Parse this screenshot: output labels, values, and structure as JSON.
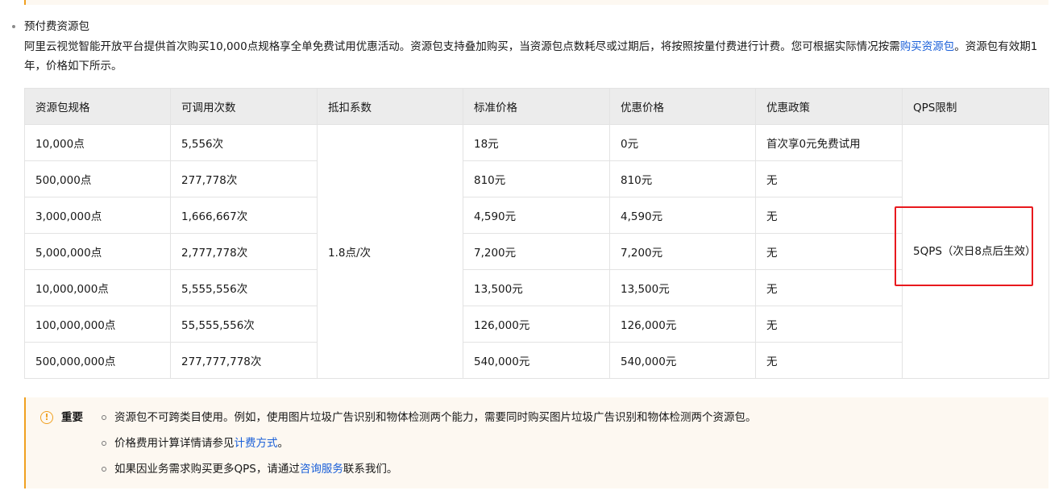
{
  "section": {
    "title": "预付费资源包",
    "intro_before_link": "阿里云视觉智能开放平台提供首次购买10,000点规格享全单免费试用优惠活动。资源包支持叠加购买，当资源包点数耗尽或过期后，将按照按量付费进行计费。您可根据实际情况按需",
    "intro_link": "购买资源包",
    "intro_after_link": "。资源包有效期1年，价格如下所示。"
  },
  "table": {
    "headers": [
      "资源包规格",
      "可调用次数",
      "抵扣系数",
      "标准价格",
      "优惠价格",
      "优惠政策",
      "QPS限制"
    ],
    "deduction": "1.8点/次",
    "qps_limit": "5QPS（次日8点后生效）",
    "rows": [
      {
        "spec": "10,000点",
        "calls": "5,556次",
        "standard": "18元",
        "discount": "0元",
        "policy": "首次享0元免费试用"
      },
      {
        "spec": "500,000点",
        "calls": "277,778次",
        "standard": "810元",
        "discount": "810元",
        "policy": "无"
      },
      {
        "spec": "3,000,000点",
        "calls": "1,666,667次",
        "standard": "4,590元",
        "discount": "4,590元",
        "policy": "无"
      },
      {
        "spec": "5,000,000点",
        "calls": "2,777,778次",
        "standard": "7,200元",
        "discount": "7,200元",
        "policy": "无"
      },
      {
        "spec": "10,000,000点",
        "calls": "5,555,556次",
        "standard": "13,500元",
        "discount": "13,500元",
        "policy": "无"
      },
      {
        "spec": "100,000,000点",
        "calls": "55,555,556次",
        "standard": "126,000元",
        "discount": "126,000元",
        "policy": "无"
      },
      {
        "spec": "500,000,000点",
        "calls": "277,777,778次",
        "standard": "540,000元",
        "discount": "540,000元",
        "policy": "无"
      }
    ]
  },
  "important": {
    "icon": "warning-circle-icon",
    "label": "重要",
    "items": [
      {
        "text": "资源包不可跨类目使用。例如，使用图片垃圾广告识别和物体检测两个能力，需要同时购买图片垃圾广告识别和物体检测两个资源包。"
      },
      {
        "text": "价格费用计算详情请参见",
        "link": "计费方式",
        "after": "。"
      },
      {
        "text": "如果因业务需求购买更多QPS，请通过",
        "link": "咨询服务",
        "after": "联系我们。"
      }
    ]
  },
  "colors": {
    "link": "#1a5fd8",
    "notice_border": "#f0a020",
    "notice_bg": "#fdf8f1",
    "highlight_box": "#e8191e",
    "table_header_bg": "#ececec"
  }
}
